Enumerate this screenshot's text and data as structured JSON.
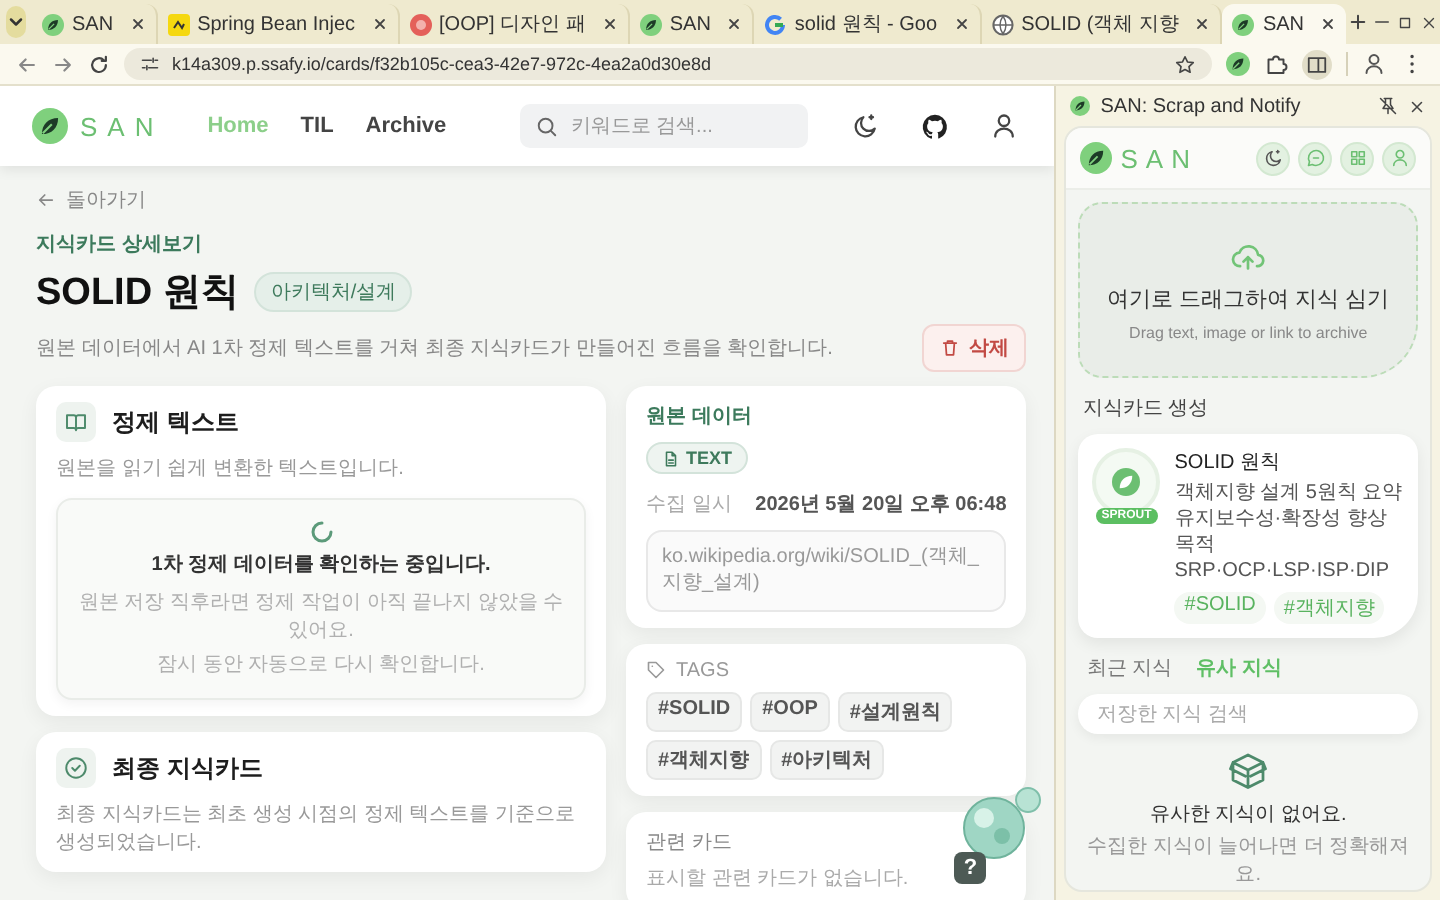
{
  "browser": {
    "tabs": [
      {
        "title": "SAN",
        "kind": "leaf",
        "selected": false
      },
      {
        "title": "Spring Bean Injec",
        "kind": "spring",
        "selected": false
      },
      {
        "title": "[OOP] 디자인 패",
        "kind": "oop",
        "selected": false
      },
      {
        "title": "SAN",
        "kind": "leaf",
        "selected": false
      },
      {
        "title": "solid 원칙 - Goo",
        "kind": "google",
        "selected": false
      },
      {
        "title": "SOLID (객체 지향",
        "kind": "wiki",
        "selected": false
      },
      {
        "title": "SAN",
        "kind": "leaf",
        "selected": true
      }
    ],
    "url": "k14a309.p.ssafy.io/cards/f32b105c-cea3-42e7-972c-4ea2a0d30e8d"
  },
  "header": {
    "logo": "SAN",
    "nav": [
      {
        "label": "Home",
        "selected": true
      },
      {
        "label": "TIL",
        "selected": false
      },
      {
        "label": "Archive",
        "selected": false
      }
    ],
    "search_placeholder": "키워드로 검색..."
  },
  "page": {
    "back": "돌아가기",
    "eyebrow": "지식카드 상세보기",
    "title": "SOLID 원칙",
    "category": "아키텍처/설계",
    "description": "원본 데이터에서 AI 1차 정제 텍스트를 거쳐 최종 지식카드가 만들어진 흐름을 확인합니다.",
    "delete": "삭제"
  },
  "refined": {
    "title": "정제 텍스트",
    "subtitle": "원본을 읽기 쉽게 변환한 텍스트입니다.",
    "status_title": "1차 정제 데이터를 확인하는 중입니다.",
    "status_lines": [
      "원본 저장 직후라면 정제 작업이 아직 끝나지 않았을 수 있어요.",
      "잠시 동안 자동으로 다시 확인합니다."
    ]
  },
  "final": {
    "title": "최종 지식카드",
    "subtitle": "최종 지식카드는 최초 생성 시점의 정제 텍스트를 기준으로 생성되었습니다."
  },
  "source": {
    "heading": "원본 데이터",
    "type": "TEXT",
    "collected_label": "수집 일시",
    "collected_at": "2026년 5월 20일 오후 06:48",
    "url": "ko.wikipedia.org/wiki/SOLID_(객체_지향_설계)"
  },
  "tags": {
    "heading": "TAGS",
    "items": [
      "#SOLID",
      "#OOP",
      "#설계원칙",
      "#객체지향",
      "#아키텍처"
    ]
  },
  "related": {
    "heading": "관련 카드",
    "empty": "표시할 관련 카드가 없습니다."
  },
  "help_badge": "?",
  "side_panel": {
    "title": "SAN: Scrap and Notify",
    "logo": "SAN",
    "drop_title": "여기로 드래그하여 지식 심기",
    "drop_hint": "Drag text, image or link to archive",
    "section": "지식카드 생성",
    "card": {
      "badge": "SPROUT",
      "title": "SOLID 원칙",
      "summary": "객체지향 설계 5원칙 요약 유지보수성·확장성 향상 목적 SRP·OCP·LSP·ISP·DIP",
      "tags": [
        "#SOLID",
        "#객체지향"
      ]
    },
    "tabs": [
      {
        "label": "최근 지식",
        "selected": false
      },
      {
        "label": "유사 지식",
        "selected": true
      }
    ],
    "search_placeholder": "저장한 지식 검색",
    "empty_title": "유사한 지식이 없어요.",
    "empty_hint": "수집한 지식이 늘어나면 더 정확해져요."
  }
}
